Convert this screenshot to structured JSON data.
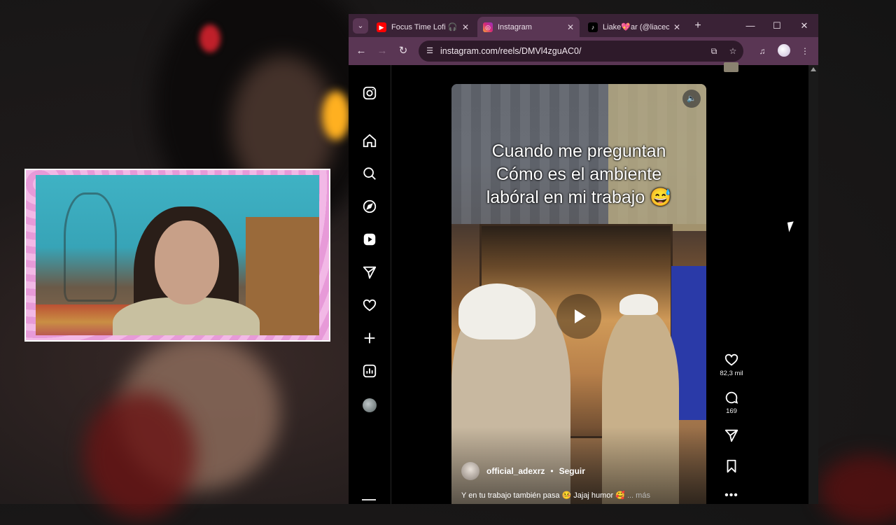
{
  "browser": {
    "tabs": [
      {
        "title": "Focus Time Lofi 🎧",
        "icon": "youtube-icon",
        "active": false
      },
      {
        "title": "Instagram",
        "icon": "instagram-icon",
        "active": true
      },
      {
        "title": "Liake💖ar (@liaceci",
        "icon": "tiktok-icon",
        "active": false
      }
    ],
    "tab_close_glyph": "✕",
    "new_tab_glyph": "+",
    "window_controls": {
      "minimize": "—",
      "maximize": "☐",
      "close": "✕"
    },
    "nav": {
      "back": "←",
      "forward": "→",
      "reload": "↻"
    },
    "url": "instagram.com/reels/DMVl4zguAC0/"
  },
  "instagram": {
    "sidebar_icons": [
      "instagram-logo-icon",
      "home-icon",
      "search-icon",
      "explore-icon",
      "reels-icon",
      "messages-icon",
      "notifications-icon",
      "create-icon",
      "dashboard-icon",
      "profile-avatar",
      "menu-icon"
    ],
    "reel": {
      "caption_lines": [
        "Cuando me preguntan",
        "Cómo es el ambiente",
        "labóral en mi trabajo 😅"
      ],
      "mute_glyph": "🔈",
      "author": "official_adexrz",
      "separator": "•",
      "follow_label": "Seguir",
      "description": "Y en tu trabajo también pasa 🤒 Jajaj humor 🥰",
      "more_label": "... más"
    },
    "actions": {
      "likes": "82,3 mil",
      "comments": "169",
      "more_glyph": "•••"
    }
  }
}
